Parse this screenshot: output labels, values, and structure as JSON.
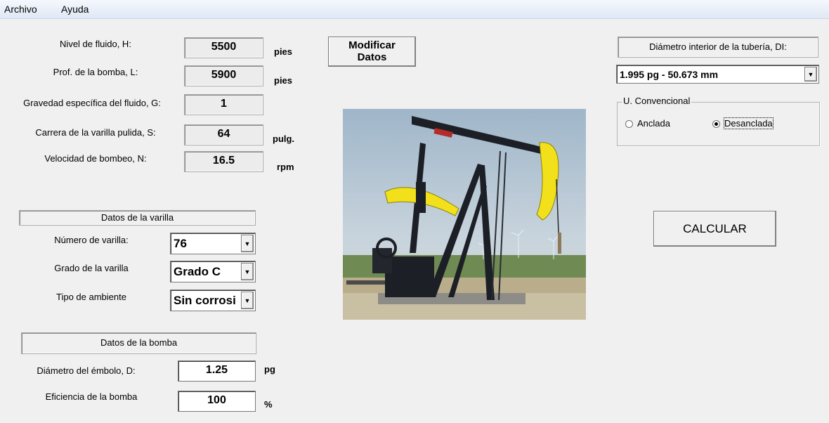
{
  "menu": {
    "archivo": "Archivo",
    "ayuda": "Ayuda"
  },
  "fields": {
    "nivel": {
      "label": "Nivel de fluido, H:",
      "value": "5500",
      "unit": "pies"
    },
    "prof": {
      "label": "Prof. de la bomba, L:",
      "value": "5900",
      "unit": "pies"
    },
    "gravedad": {
      "label": "Gravedad específica del fluido, G:",
      "value": "1"
    },
    "carrera": {
      "label": "Carrera de la varilla pulida, S:",
      "value": "64",
      "unit": "pulg."
    },
    "velocidad": {
      "label": "Velocidad de bombeo, N:",
      "value": "16.5",
      "unit": "rpm"
    }
  },
  "modificar": {
    "line1": "Modificar",
    "line2": "Datos"
  },
  "varilla": {
    "title": "Datos de la varilla",
    "numero": {
      "label": "Número de varilla:",
      "value": "76"
    },
    "grado": {
      "label": "Grado de la varilla",
      "value": "Grado C"
    },
    "ambiente": {
      "label": "Tipo de ambiente",
      "value": "Sin corrosi"
    }
  },
  "bomba": {
    "title": "Datos de la bomba",
    "diametro": {
      "label": "Diámetro del émbolo, D:",
      "value": "1.25",
      "unit": "pg"
    },
    "eficiencia": {
      "label": "Eficiencia de la bomba",
      "value": "100",
      "unit": "%"
    }
  },
  "tuberia": {
    "title": "Diámetro interior de la tubería, DI:",
    "value": "1.995 pg - 50.673 mm"
  },
  "unidad": {
    "title": "U. Convencional",
    "anclada": "Anclada",
    "desanclada": "Desanclada",
    "selected": "Desanclada"
  },
  "calcular": "CALCULAR",
  "colors": {
    "menubar": "#dfe8f5",
    "pumpjack_body": "#1c1f26",
    "counterweight": "#f2e11a"
  }
}
